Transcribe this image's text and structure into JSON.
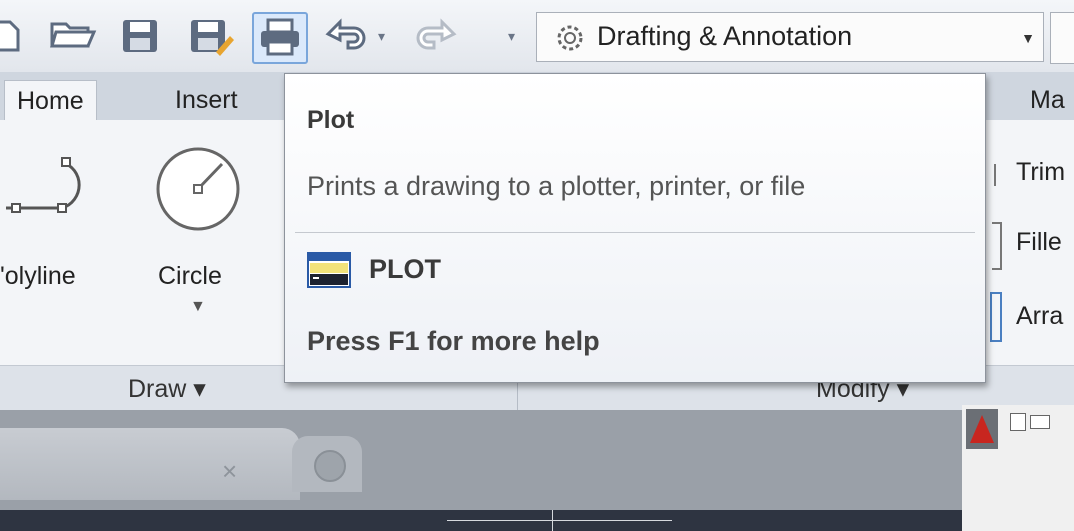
{
  "quick_access": {
    "icons": [
      "new-icon",
      "open-icon",
      "save-icon",
      "save-as-icon",
      "plot-icon",
      "undo-icon",
      "redo-icon"
    ],
    "workspace": "Drafting & Annotation"
  },
  "ribbon_tabs": [
    "Home",
    "Insert",
    "Ma"
  ],
  "draw_panel": {
    "tools": [
      "'olyline",
      "Circle"
    ],
    "title": "Draw ▾"
  },
  "modify_panel": {
    "tools": [
      "Trim",
      "Fille",
      "Arra"
    ],
    "title": "Modify ▾"
  },
  "tooltip": {
    "title": "Plot",
    "description": "Prints a drawing to a plotter, printer, or file",
    "command": "PLOT",
    "help": "Press F1 for more help"
  },
  "colors": {
    "accent": "#7aa6db",
    "autocad_red": "#c8261f"
  }
}
